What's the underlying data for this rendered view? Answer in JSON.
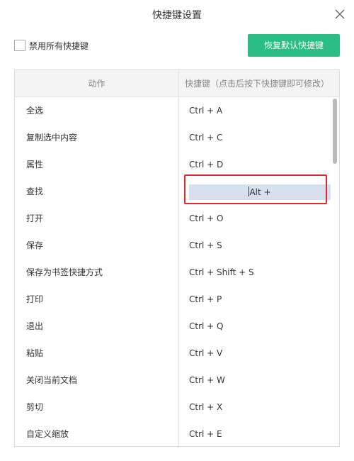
{
  "dialog": {
    "title": "快捷键设置"
  },
  "controls": {
    "disable_all_label": "禁用所有快捷键",
    "restore_default_label": "恢复默认快捷键"
  },
  "table": {
    "headers": {
      "action": "动作",
      "shortcut": "快捷键（点击后按下快捷键即可修改）"
    },
    "rows": [
      {
        "action": "全选",
        "shortcut": "Ctrl + A"
      },
      {
        "action": "复制选中内容",
        "shortcut": "Ctrl + C"
      },
      {
        "action": "属性",
        "shortcut": "Ctrl + D"
      },
      {
        "action": "查找",
        "shortcut": "Alt +"
      },
      {
        "action": "打开",
        "shortcut": "Ctrl + O"
      },
      {
        "action": "保存",
        "shortcut": "Ctrl + S"
      },
      {
        "action": "保存为书签快捷方式",
        "shortcut": "Ctrl + Shift + S"
      },
      {
        "action": "打印",
        "shortcut": "Ctrl + P"
      },
      {
        "action": "退出",
        "shortcut": "Ctrl + Q"
      },
      {
        "action": "粘贴",
        "shortcut": "Ctrl + V"
      },
      {
        "action": "关闭当前文档",
        "shortcut": "Ctrl + W"
      },
      {
        "action": "剪切",
        "shortcut": "Ctrl + X"
      },
      {
        "action": "自定义缩放",
        "shortcut": "Ctrl + E"
      }
    ]
  },
  "colors": {
    "accent": "#2bbd86",
    "highlight": "#e02a2a",
    "edit_bg": "#d7e0ee"
  },
  "icons": {
    "close": "close-icon"
  }
}
